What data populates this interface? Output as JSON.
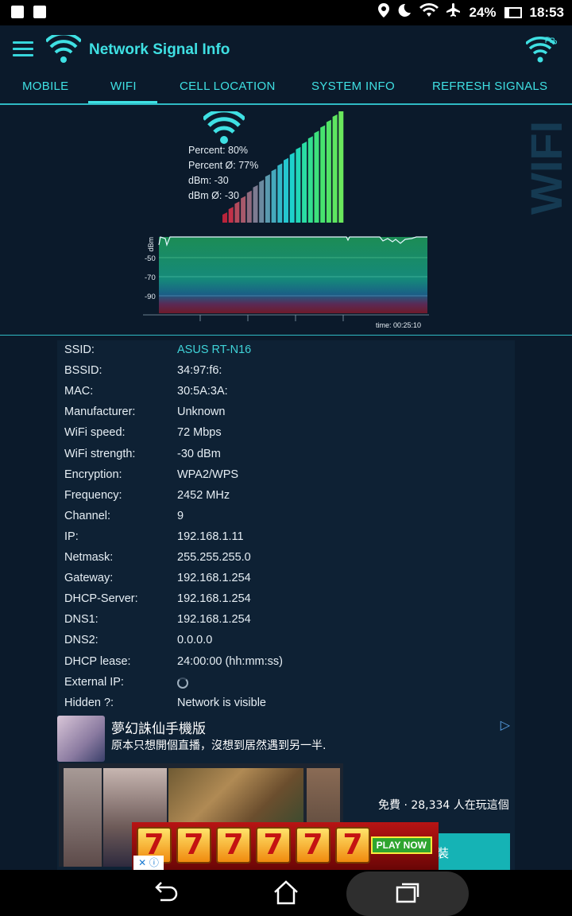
{
  "status_bar": {
    "battery": "24%",
    "time": "18:53"
  },
  "app": {
    "title": "Network Signal Info"
  },
  "tabs": [
    {
      "label": "MOBILE",
      "active": false
    },
    {
      "label": "WIFI",
      "active": true
    },
    {
      "label": "CELL LOCATION",
      "active": false
    },
    {
      "label": "SYSTEM INFO",
      "active": false
    },
    {
      "label": "REFRESH SIGNALS",
      "active": false
    }
  ],
  "signal": {
    "percent": "Percent: 80%",
    "percent_avg": "Percent Ø: 77%",
    "dbm": "dBm: -30",
    "dbm_avg": "dBm Ø: -30",
    "bar_level": 0.8,
    "side_label": "WIFI"
  },
  "graph": {
    "y_unit": "dBm",
    "y_ticks": [
      "-50",
      "-70",
      "-90"
    ],
    "time_label": "time: 00:25:10"
  },
  "info": {
    "rows": [
      {
        "key": "SSID:",
        "value": "ASUS RT-N16"
      },
      {
        "key": "BSSID:",
        "value": "34:97:f6:"
      },
      {
        "key": "MAC:",
        "value": "30:5A:3A:"
      },
      {
        "key": "Manufacturer:",
        "value": "Unknown"
      },
      {
        "key": "WiFi speed:",
        "value": "72 Mbps"
      },
      {
        "key": "WiFi strength:",
        "value": "-30 dBm"
      },
      {
        "key": "Encryption:",
        "value": "WPA2/WPS"
      },
      {
        "key": "Frequency:",
        "value": "2452 MHz"
      },
      {
        "key": "Channel:",
        "value": "9"
      },
      {
        "key": "IP:",
        "value": "192.168.1.11"
      },
      {
        "key": "Netmask:",
        "value": "255.255.255.0"
      },
      {
        "key": "Gateway:",
        "value": "192.168.1.254"
      },
      {
        "key": "DHCP-Server:",
        "value": "192.168.1.254"
      },
      {
        "key": "DNS1:",
        "value": "192.168.1.254"
      },
      {
        "key": "DNS2:",
        "value": "0.0.0.0"
      },
      {
        "key": "DHCP lease:",
        "value": "24:00:00 (hh:mm:ss)"
      },
      {
        "key": "External IP:",
        "value": ""
      },
      {
        "key": "Hidden ?:",
        "value": "Network is visible"
      }
    ]
  },
  "ad": {
    "title": "夢幻誅仙手機版",
    "description": "原本只想開個直播，沒想到居然遇到另一半.",
    "players": "免費 · 28,334 人在玩這個",
    "install": "裝"
  },
  "banner": {
    "digit": "7",
    "cta": "PLAY NOW"
  },
  "colors": {
    "accent": "#3fe0e3",
    "background": "#0b1a2b"
  }
}
